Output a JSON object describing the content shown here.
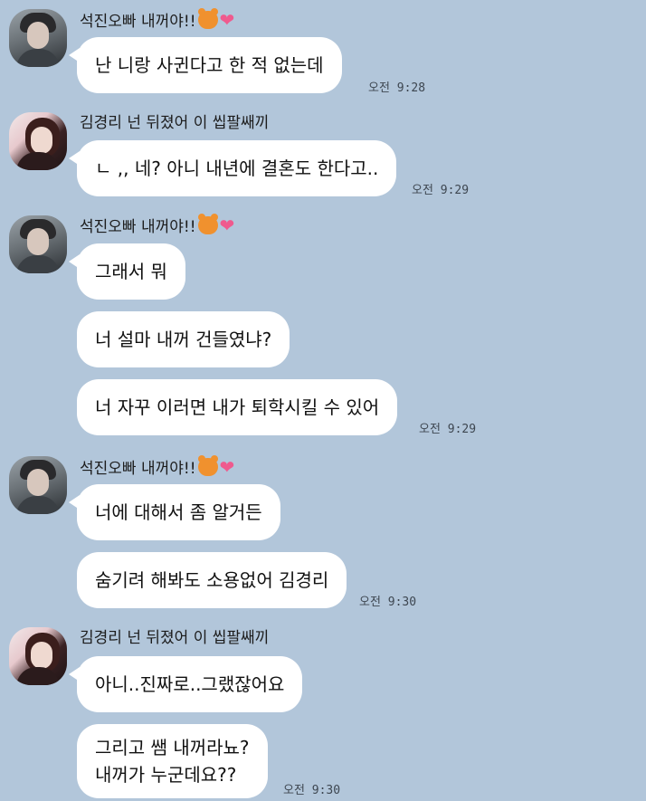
{
  "senders": {
    "seokjin": "석진오빠 내꺼야!!",
    "kyungri": "김경리 넌 뒤졌어 이 씹팔쌔끼"
  },
  "icons": {
    "bear": "bear-face-emoji",
    "heart": "pink-heart-emoji",
    "heart_glyph": "❤"
  },
  "colors": {
    "background": "#b2c6da",
    "bubble": "#ffffff"
  },
  "messages": {
    "m1": "난 니랑 사귄다고 한 적 없는데",
    "m2": "ㄴ ,, 네? 아니 내년에 결혼도 한다고..",
    "m3": "그래서 뭐",
    "m4": "너 설마 내꺼 건들였냐?",
    "m5": "너 자꾸 이러면 내가 퇴학시킬 수 있어",
    "m6": "너에 대해서 좀 알거든",
    "m7": "숨기려 해봐도 소용없어 김경리",
    "m8": "아니..진짜로..그랬잖어요",
    "m9_line1": "그리고 쌤 내꺼라뇨?",
    "m9_line2": "내꺼가 누군데요??"
  },
  "times": {
    "t1": "오전 9:28",
    "t2": "오전 9:29",
    "t3": "오전 9:29",
    "t4": "오전 9:30",
    "t5": "오전 9:30"
  }
}
